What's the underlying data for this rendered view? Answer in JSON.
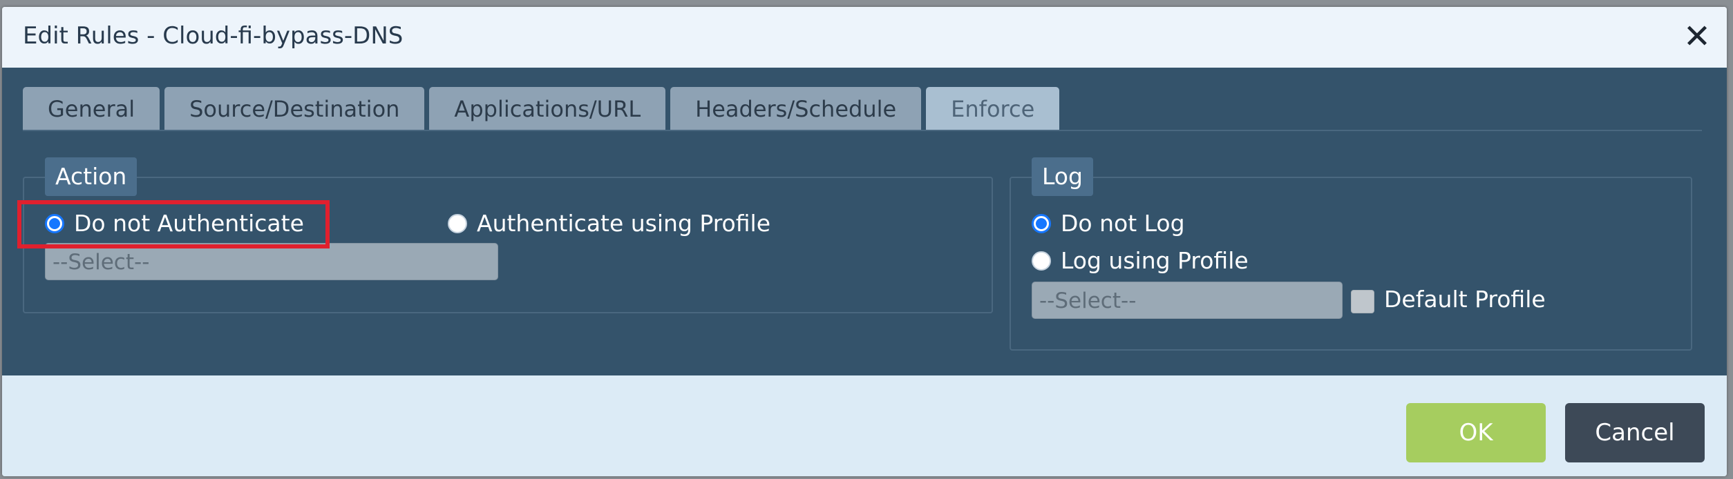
{
  "dialog": {
    "title": "Edit Rules - Cloud-fi-bypass-DNS",
    "close_icon": "close-icon"
  },
  "tabs": [
    {
      "label": "General",
      "active": false
    },
    {
      "label": "Source/Destination",
      "active": false
    },
    {
      "label": "Applications/URL",
      "active": false
    },
    {
      "label": "Headers/Schedule",
      "active": false
    },
    {
      "label": "Enforce",
      "active": true
    }
  ],
  "action": {
    "legend": "Action",
    "options": [
      {
        "label": "Do not Authenticate",
        "checked": true
      },
      {
        "label": "Authenticate using Profile",
        "checked": false
      }
    ],
    "select_value": "--Select--"
  },
  "log": {
    "legend": "Log",
    "options": [
      {
        "label": "Do not Log",
        "checked": true
      },
      {
        "label": "Log using Profile",
        "checked": false
      }
    ],
    "select_value": "--Select--",
    "default_profile_label": "Default Profile",
    "default_profile_checked": false
  },
  "footer": {
    "ok_label": "OK",
    "cancel_label": "Cancel"
  },
  "colors": {
    "panel": "#34536b",
    "ok": "#a6cd5f",
    "cancel": "#3d4957",
    "highlight": "#e0202e",
    "radio_selected": "#1677ff"
  }
}
